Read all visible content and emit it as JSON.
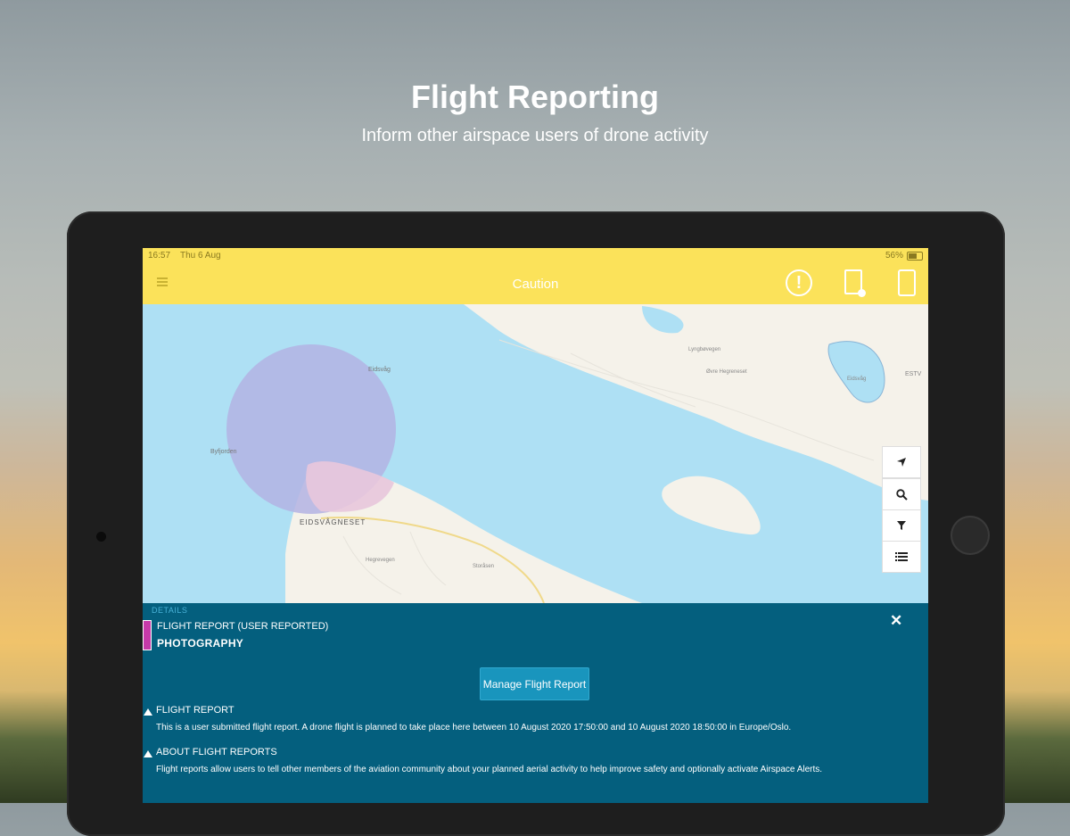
{
  "hero": {
    "title": "Flight Reporting",
    "subtitle": "Inform other airspace users of drone activity"
  },
  "status_bar": {
    "time": "16:57",
    "date": "Thu 6 Aug",
    "battery": "56%"
  },
  "app_bar": {
    "title": "Caution"
  },
  "map": {
    "labels": {
      "bridge": "Eidsvåg",
      "bay": "Byfjorden",
      "peninsula": "EIDSVÅGNESET",
      "road_a": "Lyngbøvegen",
      "road_b": "Øvre Hegreneset",
      "road_c": "Hegrevegen",
      "road_d": "Storåsen",
      "place_a": "Eidsvåg",
      "place_b": "ESTV"
    }
  },
  "panel": {
    "details_label": "DETAILS",
    "report_type": "FLIGHT REPORT (USER REPORTED)",
    "report_name": "PHOTOGRAPHY",
    "manage_button": "Manage Flight Report",
    "sections": [
      {
        "title": "FLIGHT REPORT",
        "body": "This is a user submitted flight report. A drone flight is planned to take place here between 10 August 2020 17:50:00 and 10 August 2020 18:50:00 in Europe/Oslo."
      },
      {
        "title": "ABOUT FLIGHT REPORTS",
        "body": "Flight reports allow users to tell other members of the aviation community about your planned aerial activity to help improve safety and optionally activate Airspace Alerts."
      }
    ]
  },
  "colors": {
    "status_bar": "#fbe25a",
    "panel": "#045f7e",
    "water": "#aee0f4",
    "land": "#f5f2ea",
    "flight_area": "#b3b3e3",
    "report_marker": "#c63aa9",
    "button": "#1995bd"
  },
  "icons": [
    "menu-icon",
    "alert-icon",
    "flight-report-icon",
    "device-icon",
    "locate-icon",
    "search-icon",
    "filter-icon",
    "list-icon",
    "close-icon",
    "warning-icon"
  ]
}
